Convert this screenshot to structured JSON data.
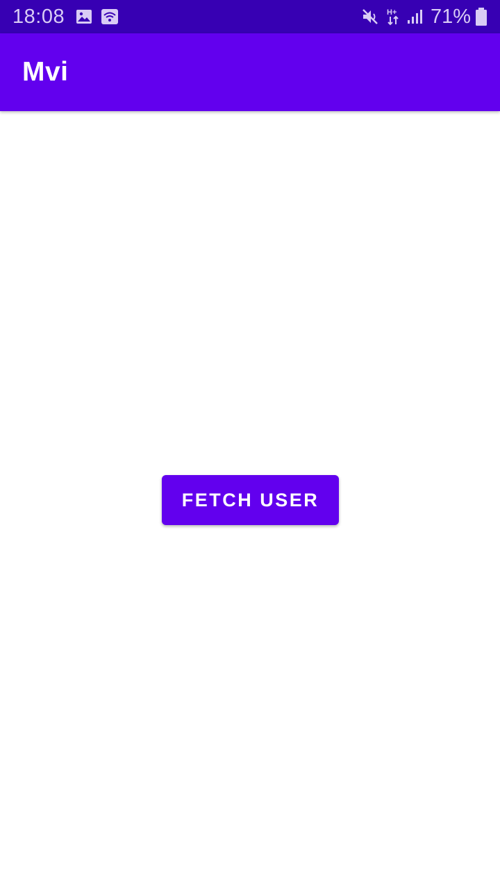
{
  "status_bar": {
    "time": "18:08",
    "battery_percent": "71%",
    "network_type": "H+",
    "icons_left": [
      "image-icon",
      "wifi-hotspot-icon"
    ],
    "icons_right": [
      "mute-icon",
      "network-type-icon",
      "signal-icon",
      "battery-icon"
    ],
    "background_color": "#3700b3"
  },
  "app_bar": {
    "title": "Mvi",
    "background_color": "#6200ee"
  },
  "main": {
    "fetch_button_label": "FETCH USER",
    "button_color": "#6200ee"
  }
}
